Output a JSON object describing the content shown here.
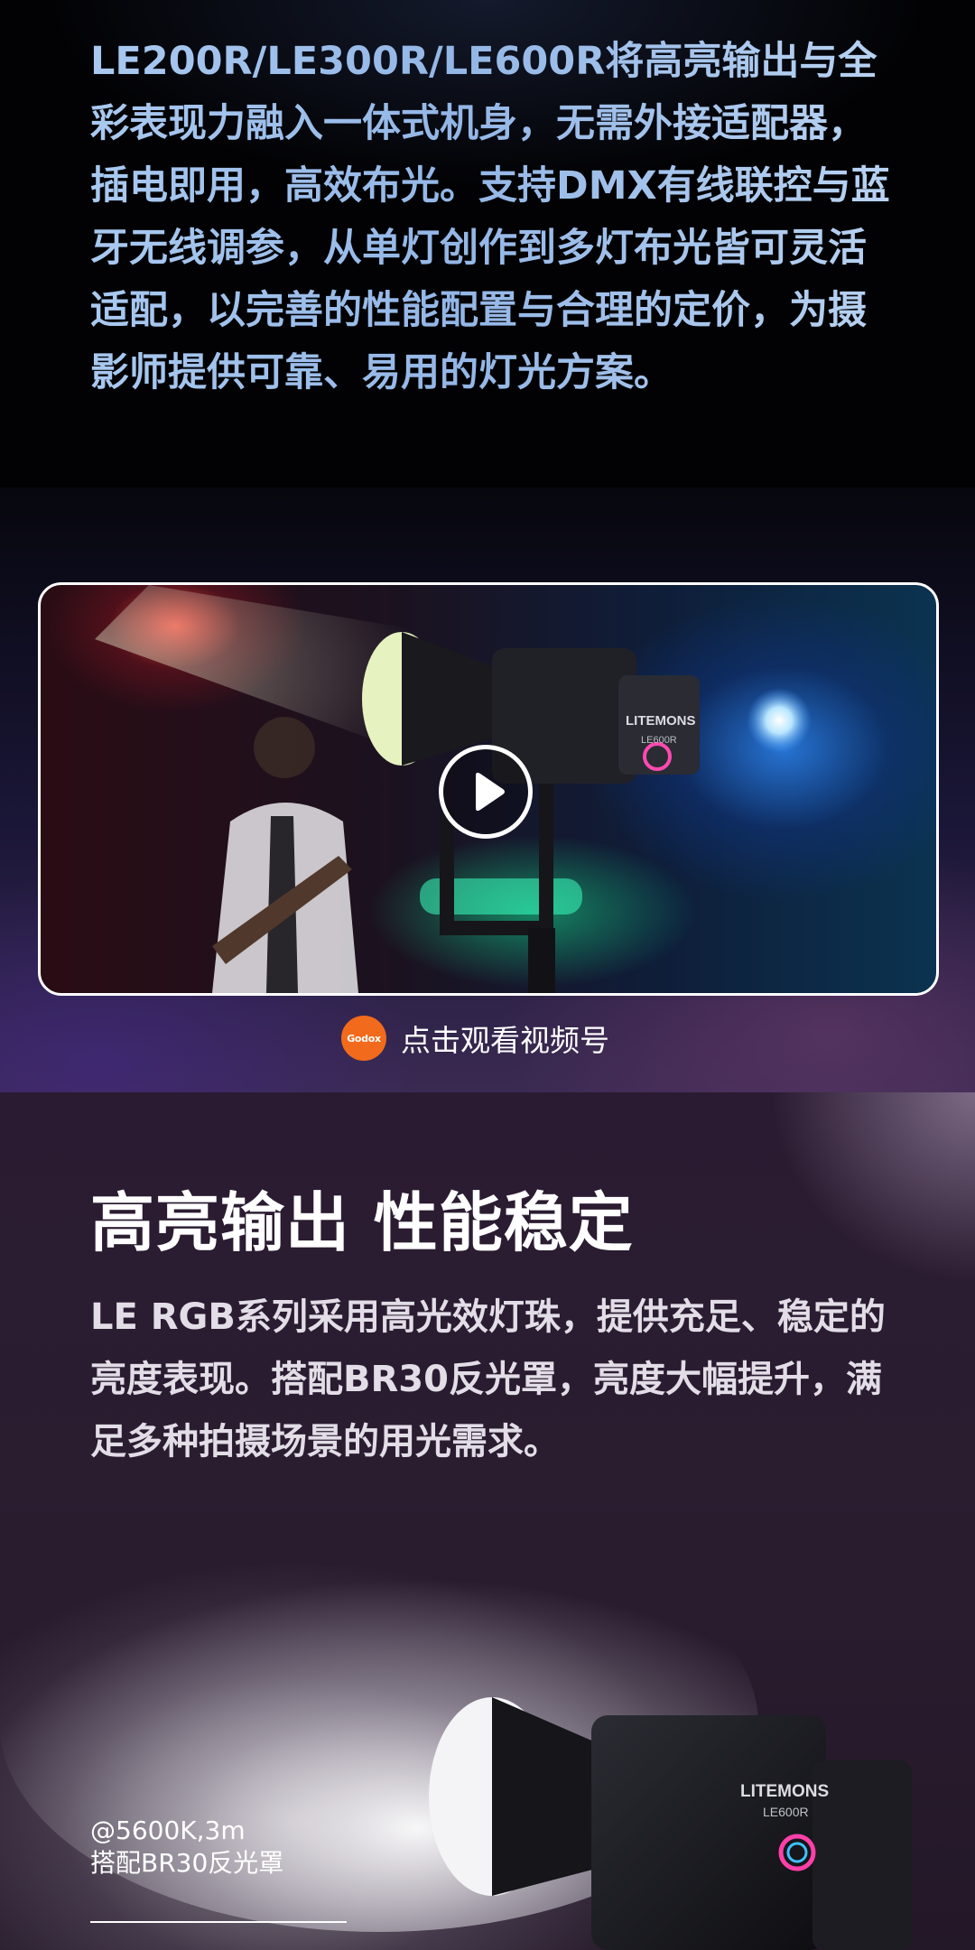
{
  "intro": {
    "text": "LE200R/LE300R/LE600R将高亮输出与全彩表现力融入一体式机身，无需外接适配器，插电即用，高效布光。支持DMX有线联控与蓝牙无线调参，从单灯创作到多灯布光皆可灵活适配，以完善的性能配置与合理的定价，为摄影师提供可靠、易用的灯光方案。"
  },
  "video": {
    "light_brand": "LITEMONS",
    "light_model": "LE600R",
    "play_icon": "play-icon",
    "logo_text": "Godox",
    "caption": "点击观看视频号"
  },
  "feature": {
    "title": "高亮输出 性能稳定",
    "description": "LE RGB系列采用高光效灯珠，提供充足、稳定的亮度表现。搭配BR30反光罩，亮度大幅提升，满足多种拍摄场景的用光需求。",
    "light_brand": "LITEMONS",
    "light_model": "LE600R",
    "note_line1": "@5600K,3m",
    "note_line2": "搭配BR30反光罩"
  },
  "colors": {
    "intro_text": "#9ebde6",
    "brand_logo": "#f26a1b",
    "title": "#ffffff"
  }
}
